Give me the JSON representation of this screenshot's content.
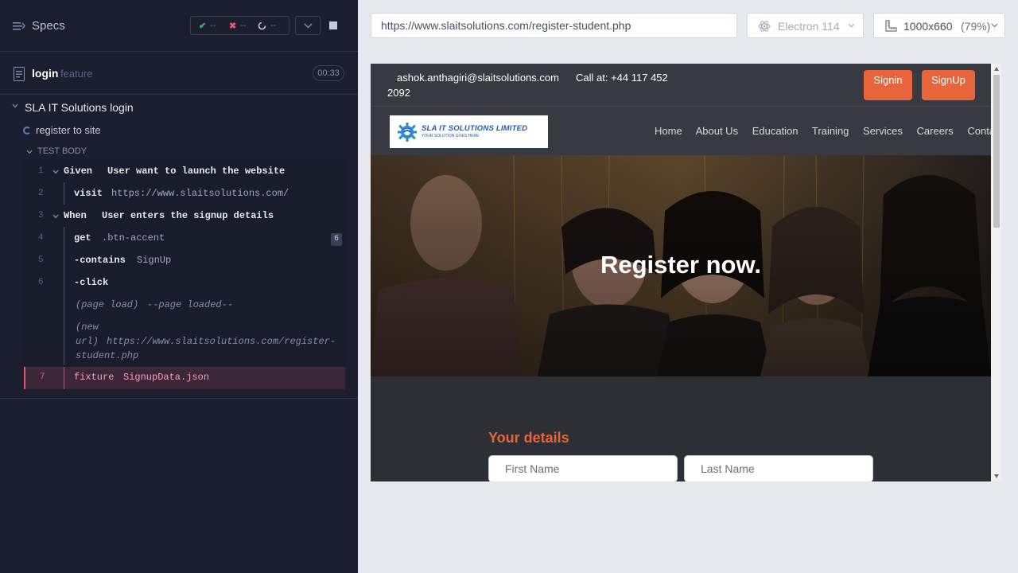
{
  "log": {
    "specs_label": "Specs",
    "stats": {
      "passed": "--",
      "failed": "--",
      "pending": "--"
    },
    "spec_file": {
      "name": "login",
      "ext": "feature",
      "duration": "00:33"
    },
    "suite_title": "SLA IT Solutions login",
    "test_title": "register to site",
    "body_title": "TEST BODY",
    "commands": [
      {
        "num": "1",
        "kw": "Given",
        "arg": "User want to launch the website"
      },
      {
        "num": "2",
        "kw": "visit",
        "arg": "https://www.slaitsolutions.com/"
      },
      {
        "num": "3",
        "kw": "When",
        "arg": "User enters the signup details"
      },
      {
        "num": "4",
        "kw": "get",
        "arg": ".btn-accent",
        "badge": "6"
      },
      {
        "num": "5",
        "kw": "-contains",
        "arg": "SignUp"
      },
      {
        "num": "6",
        "kw": "-click",
        "arg": ""
      },
      {
        "label": "(page load)",
        "arg": "--page loaded--"
      },
      {
        "label_line1": "(new",
        "label_line2": "url)",
        "arg_line1": "https://www.slaitsolutions.com/register-",
        "arg_line2": "student.php"
      },
      {
        "num": "7",
        "kw": "fixture",
        "arg": "SignupData.json"
      }
    ]
  },
  "aut": {
    "url": "https://www.slaitsolutions.com/register-student.php",
    "browser": "Electron 114",
    "viewport": "1000x660",
    "scale": "(79%)"
  },
  "site": {
    "email": "ashok.anthagiri@slaitsolutions.com",
    "call": "Call at: +44 117 452",
    "call_tail": "2092",
    "signin": "Signin",
    "signup": "SignUp",
    "logo_text": "SLA IT SOLUTIONS LIMITED",
    "logo_sub": "YOUR SOLUTION GOES HERE",
    "nav": [
      "Home",
      "About Us",
      "Education",
      "Training",
      "Services",
      "Careers",
      "Contact"
    ],
    "hero_title": "Register now.",
    "section_title": "Your details",
    "first_name_placeholder": "First Name",
    "last_name_placeholder": "Last Name"
  },
  "colors": {
    "accent": "#e8643a",
    "pass": "#2fbf6d",
    "fail": "#e45770",
    "log_bg": "#1b1e2e"
  }
}
